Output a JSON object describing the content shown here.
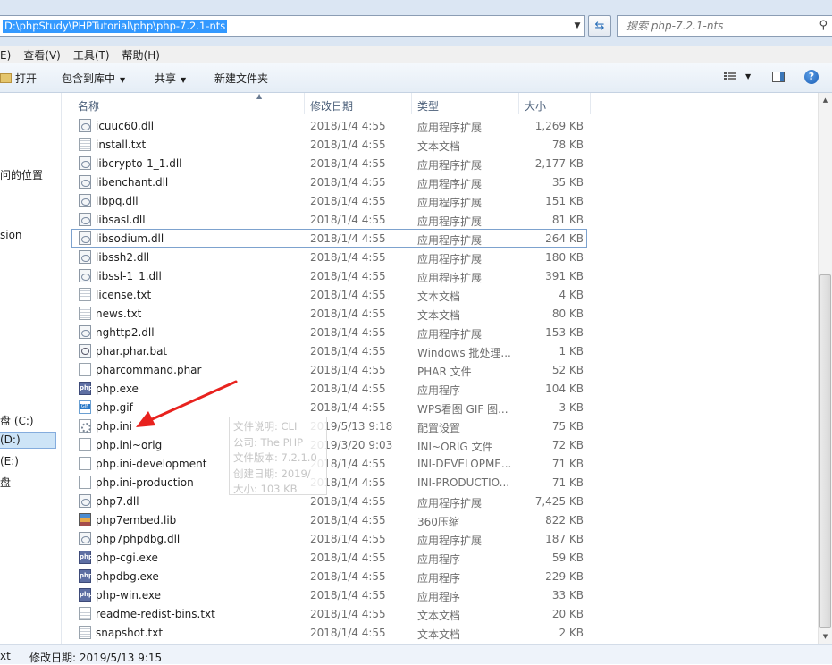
{
  "address_bar": {
    "path": "D:\\phpStudy\\PHPTutorial\\php\\php-7.2.1-nts",
    "search_placeholder": "搜索 php-7.2.1-nts"
  },
  "menu": {
    "edit": "E)",
    "view": "查看(V)",
    "tools": "工具(T)",
    "help": "帮助(H)"
  },
  "toolbar": {
    "open": "打开",
    "include_in_library": "包含到库中",
    "share": "共享",
    "new_folder": "新建文件夹",
    "help_glyph": "?"
  },
  "nav_pane": {
    "items": [
      "问的位置",
      "sion",
      "盘 (C:)",
      "(D:)",
      "(E:)",
      "盘"
    ]
  },
  "columns": {
    "name": "名称",
    "date": "修改日期",
    "type": "类型",
    "size": "大小"
  },
  "files": [
    {
      "name": "icuuc60.dll",
      "date": "2018/1/4 4:55",
      "type": "应用程序扩展",
      "size": "1,269 KB",
      "icon": "dll-icon"
    },
    {
      "name": "install.txt",
      "date": "2018/1/4 4:55",
      "type": "文本文档",
      "size": "78 KB",
      "icon": "text-file-icon"
    },
    {
      "name": "libcrypto-1_1.dll",
      "date": "2018/1/4 4:55",
      "type": "应用程序扩展",
      "size": "2,177 KB",
      "icon": "dll-icon"
    },
    {
      "name": "libenchant.dll",
      "date": "2018/1/4 4:55",
      "type": "应用程序扩展",
      "size": "35 KB",
      "icon": "dll-icon"
    },
    {
      "name": "libpq.dll",
      "date": "2018/1/4 4:55",
      "type": "应用程序扩展",
      "size": "151 KB",
      "icon": "dll-icon"
    },
    {
      "name": "libsasl.dll",
      "date": "2018/1/4 4:55",
      "type": "应用程序扩展",
      "size": "81 KB",
      "icon": "dll-icon"
    },
    {
      "name": "libsodium.dll",
      "date": "2018/1/4 4:55",
      "type": "应用程序扩展",
      "size": "264 KB",
      "icon": "dll-icon"
    },
    {
      "name": "libssh2.dll",
      "date": "2018/1/4 4:55",
      "type": "应用程序扩展",
      "size": "180 KB",
      "icon": "dll-icon"
    },
    {
      "name": "libssl-1_1.dll",
      "date": "2018/1/4 4:55",
      "type": "应用程序扩展",
      "size": "391 KB",
      "icon": "dll-icon"
    },
    {
      "name": "license.txt",
      "date": "2018/1/4 4:55",
      "type": "文本文档",
      "size": "4 KB",
      "icon": "text-file-icon"
    },
    {
      "name": "news.txt",
      "date": "2018/1/4 4:55",
      "type": "文本文档",
      "size": "80 KB",
      "icon": "text-file-icon"
    },
    {
      "name": "nghttp2.dll",
      "date": "2018/1/4 4:55",
      "type": "应用程序扩展",
      "size": "153 KB",
      "icon": "dll-icon"
    },
    {
      "name": "phar.phar.bat",
      "date": "2018/1/4 4:55",
      "type": "Windows 批处理...",
      "size": "1 KB",
      "icon": "batch-file-icon"
    },
    {
      "name": "pharcommand.phar",
      "date": "2018/1/4 4:55",
      "type": "PHAR 文件",
      "size": "52 KB",
      "icon": "blank-file-icon"
    },
    {
      "name": "php.exe",
      "date": "2018/1/4 4:55",
      "type": "应用程序",
      "size": "104 KB",
      "icon": "php-exe-icon"
    },
    {
      "name": "php.gif",
      "date": "2018/1/4 4:55",
      "type": "WPS看图 GIF 图...",
      "size": "3 KB",
      "icon": "gif-image-icon"
    },
    {
      "name": "php.ini",
      "date": "2019/5/13 9:18",
      "type": "配置设置",
      "size": "75 KB",
      "icon": "config-file-icon"
    },
    {
      "name": "php.ini~orig",
      "date": "2019/3/20 9:03",
      "type": "INI~ORIG 文件",
      "size": "72 KB",
      "icon": "blank-file-icon"
    },
    {
      "name": "php.ini-development",
      "date": "2018/1/4 4:55",
      "type": "INI-DEVELOPME...",
      "size": "71 KB",
      "icon": "blank-file-icon"
    },
    {
      "name": "php.ini-production",
      "date": "2018/1/4 4:55",
      "type": "INI-PRODUCTIO...",
      "size": "71 KB",
      "icon": "blank-file-icon"
    },
    {
      "name": "php7.dll",
      "date": "2018/1/4 4:55",
      "type": "应用程序扩展",
      "size": "7,425 KB",
      "icon": "dll-icon"
    },
    {
      "name": "php7embed.lib",
      "date": "2018/1/4 4:55",
      "type": "360压缩",
      "size": "822 KB",
      "icon": "archive-icon"
    },
    {
      "name": "php7phpdbg.dll",
      "date": "2018/1/4 4:55",
      "type": "应用程序扩展",
      "size": "187 KB",
      "icon": "dll-icon"
    },
    {
      "name": "php-cgi.exe",
      "date": "2018/1/4 4:55",
      "type": "应用程序",
      "size": "59 KB",
      "icon": "php-exe-icon"
    },
    {
      "name": "phpdbg.exe",
      "date": "2018/1/4 4:55",
      "type": "应用程序",
      "size": "229 KB",
      "icon": "php-exe-icon"
    },
    {
      "name": "php-win.exe",
      "date": "2018/1/4 4:55",
      "type": "应用程序",
      "size": "33 KB",
      "icon": "php-exe-icon"
    },
    {
      "name": "readme-redist-bins.txt",
      "date": "2018/1/4 4:55",
      "type": "文本文档",
      "size": "20 KB",
      "icon": "text-file-icon"
    },
    {
      "name": "snapshot.txt",
      "date": "2018/1/4 4:55",
      "type": "文本文档",
      "size": "2 KB",
      "icon": "text-file-icon"
    }
  ],
  "focused_row": "libsodium.dll",
  "tooltip": [
    "文件说明: CLI",
    "公司: The PHP",
    "文件版本: 7.2.1.0",
    "创建日期: 2019/",
    "大小: 103 KB"
  ],
  "status_bar": {
    "type_fragment": "xt",
    "modified": "修改日期: 2019/5/13 9:15"
  },
  "colors": {
    "address_selection": "#3399ff",
    "annotation_arrow": "#e8221e",
    "chrome_background": "#dbe6f3"
  }
}
